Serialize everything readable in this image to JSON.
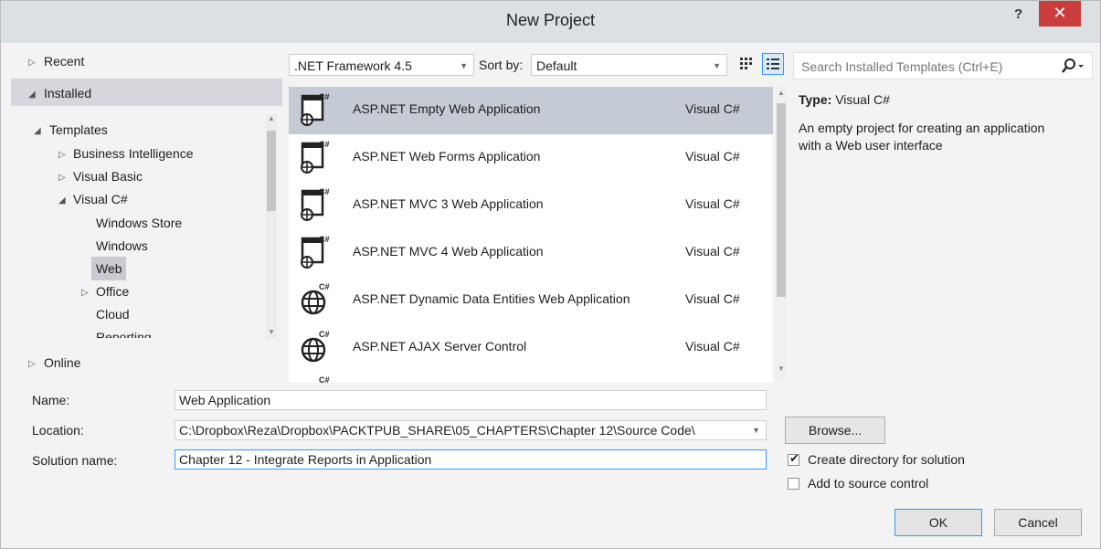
{
  "window": {
    "title": "New Project",
    "help": "?",
    "close": "✕"
  },
  "nav": {
    "recent": "Recent",
    "installed": "Installed",
    "templates": "Templates",
    "business_intelligence": "Business Intelligence",
    "visual_basic": "Visual Basic",
    "visual_csharp": "Visual C#",
    "windows_store": "Windows Store",
    "windows": "Windows",
    "web": "Web",
    "office": "Office",
    "cloud": "Cloud",
    "reporting": "Reporting",
    "online": "Online"
  },
  "toolbar": {
    "framework": ".NET Framework 4.5",
    "sort_label": "Sort by:",
    "sort_value": "Default",
    "search_placeholder": "Search Installed Templates (Ctrl+E)"
  },
  "templates": [
    {
      "name": "ASP.NET Empty Web Application",
      "lang": "Visual C#",
      "selected": true,
      "icon": "web-app-icon"
    },
    {
      "name": "ASP.NET Web Forms Application",
      "lang": "Visual C#",
      "selected": false,
      "icon": "web-app-icon"
    },
    {
      "name": "ASP.NET MVC 3 Web Application",
      "lang": "Visual C#",
      "selected": false,
      "icon": "web-app-icon"
    },
    {
      "name": "ASP.NET MVC 4 Web Application",
      "lang": "Visual C#",
      "selected": false,
      "icon": "web-app-icon"
    },
    {
      "name": "ASP.NET Dynamic Data Entities Web Application",
      "lang": "Visual C#",
      "selected": false,
      "icon": "globe-icon"
    },
    {
      "name": "ASP.NET AJAX Server Control",
      "lang": "Visual C#",
      "selected": false,
      "icon": "globe-icon"
    }
  ],
  "info": {
    "type_label": "Type:",
    "type_value": "Visual C#",
    "description": "An empty project for creating an application with a Web user interface"
  },
  "form": {
    "name_label": "Name:",
    "name_value": "Web Application",
    "location_label": "Location:",
    "location_value": "C:\\Dropbox\\Reza\\Dropbox\\PACKTPUB_SHARE\\05_CHAPTERS\\Chapter 12\\Source Code\\",
    "solution_label": "Solution name:",
    "solution_value": "Chapter 12 - Integrate Reports in Application",
    "browse": "Browse...",
    "create_dir": "Create directory for solution",
    "add_source": "Add to source control",
    "ok": "OK",
    "cancel": "Cancel"
  },
  "colors": {
    "accent": "#3399ff",
    "close": "#c93d3c",
    "selected_row": "#c5cbd4"
  }
}
